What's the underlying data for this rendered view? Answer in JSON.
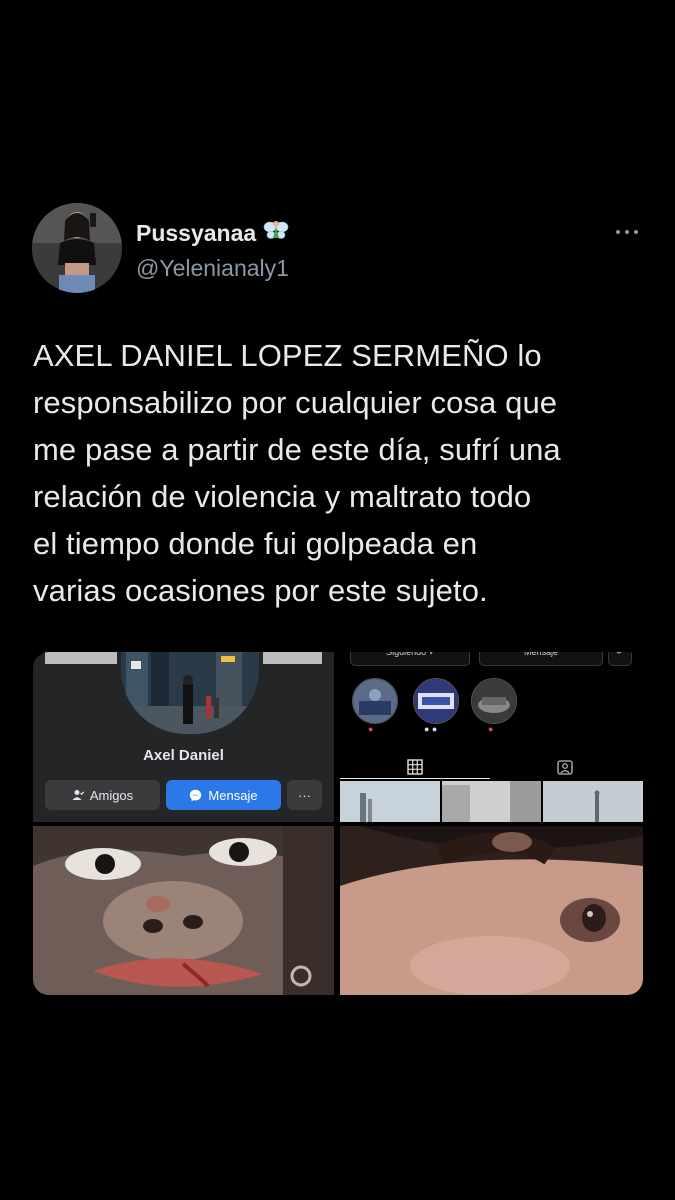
{
  "tweet": {
    "author": {
      "display_name": "Pussyanaa",
      "name_emoji_icon": "fairy-icon",
      "handle": "@Yelenianaly1"
    },
    "more_icon": "more-horizontal-icon",
    "text_lines": [
      "AXEL DANIEL LOPEZ SERMEÑO lo",
      "responsabilizo por cualquier cosa que",
      "me pase a partir de este día, sufrí una",
      "relación de violencia y maltrato todo",
      "el tiempo donde fui golpeada en",
      "varias ocasiones por este sujeto."
    ],
    "media": {
      "facebook_profile": {
        "name": "Axel Daniel",
        "friends_button": "Amigos",
        "message_button": "Mensaje",
        "more_button": "···"
      },
      "instagram_profile": {
        "follow_button": "Siguiendo ˅",
        "message_button": "Mensaje"
      }
    }
  },
  "colors": {
    "background": "#000000",
    "text_primary": "#e7e9ea",
    "text_secondary": "#8b98a5",
    "facebook_blue": "#2d78e8"
  }
}
